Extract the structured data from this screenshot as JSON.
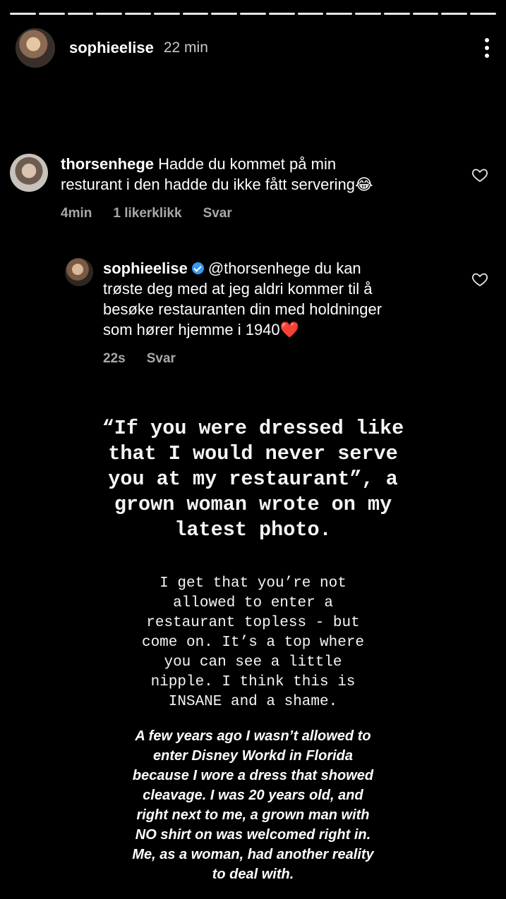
{
  "story": {
    "username": "sophieelise",
    "time": "22 min",
    "progress_segments": 17
  },
  "comment": {
    "username": "thorsenhege",
    "text_line1": "Hadde du kommet på min",
    "text_line2": "resturant i den hadde du ikke fått servering",
    "emoji": "😂",
    "time": "4min",
    "likes": "1 likerklikk",
    "reply_label": "Svar",
    "heart_icon": "heart-outline-icon"
  },
  "reply": {
    "username": "sophieelise",
    "mention": "@thorsenhege du kan",
    "text_line2": "trøste deg med at jeg aldri kommer til å",
    "text_line3": "besøke restauranten din med holdninger",
    "text_line4": "som hører hjemme i 1940",
    "emoji": "❤️",
    "time": "22s",
    "reply_label": "Svar",
    "heart_icon": "heart-outline-icon"
  },
  "caption_big": [
    "“If you were dressed like",
    "that I would never serve",
    "you at my restaurant”, a",
    "grown woman wrote on my",
    "latest photo."
  ],
  "caption_mid": [
    "I get that you’re not",
    "allowed to enter a",
    "restaurant topless - but",
    "come on. It’s a top where",
    "you can see a little",
    "nipple. I think this is",
    "INSANE and a shame."
  ],
  "caption_bottom": [
    "A few years ago I wasn’t allowed to",
    "enter Disney Workd in Florida",
    "because I wore a dress that showed",
    "cleavage. I was 20 years old, and",
    "right next to me, a grown man with",
    "NO shirt on was welcomed right in.",
    "Me, as a woman, had another reality",
    "to deal with."
  ]
}
